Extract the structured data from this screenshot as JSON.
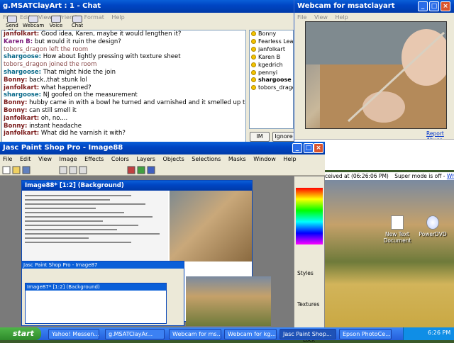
{
  "chat": {
    "title": "g.MSATClayArt : 1 - Chat",
    "menu": [
      "File",
      "Edit",
      "View",
      "Friend",
      "Format",
      "Help"
    ],
    "toolbar": [
      "Send File",
      "Webcam",
      "Voice",
      "Chat"
    ],
    "messages": [
      {
        "nick": "janfolkart:",
        "text": "Good idea, Karen, maybe it would lengthen it?",
        "color": "#7a1a1a"
      },
      {
        "nick": "Karen B:",
        "text": "but would it ruin the design?",
        "color": "#7a1a7a"
      },
      {
        "nick": "",
        "text": "tobors_dragon left the room",
        "color": "#8a4a4a"
      },
      {
        "nick": "shargoose:",
        "text": "How about lightly pressing with texture sheet",
        "color": "#0a6a8a"
      },
      {
        "nick": "",
        "text": "tobors_dragon joined the room",
        "color": "#8a4a4a"
      },
      {
        "nick": "shargoose:",
        "text": "That might hide the join",
        "color": "#0a6a8a"
      },
      {
        "nick": "Bonny:",
        "text": "back..that stunk lol",
        "color": "#7a1a1a"
      },
      {
        "nick": "janfolkart:",
        "text": "what happened?",
        "color": "#7a1a1a"
      },
      {
        "nick": "shargoose:",
        "text": "NJ goofed on the measurement",
        "color": "#0a6a8a"
      },
      {
        "nick": "Bonny:",
        "text": "hubby came in with a bowl he turned and varnished and it smelled up the joint",
        "color": "#7a1a1a"
      },
      {
        "nick": "Bonny:",
        "text": "can still smell it",
        "color": "#7a1a1a"
      },
      {
        "nick": "janfolkart:",
        "text": "oh, no....",
        "color": "#7a1a1a"
      },
      {
        "nick": "Bonny:",
        "text": "instant headache",
        "color": "#7a1a1a"
      },
      {
        "nick": "janfolkart:",
        "text": "What did he varnish it with?",
        "color": "#7a1a1a"
      }
    ],
    "users": [
      "Bonny",
      "Fearless Leader",
      "janfolkart",
      "Karen B",
      "kgedrich",
      "pennyi",
      "shargoose",
      "tobors_dragon"
    ],
    "bold_user": "shargoose",
    "im_button": "IM",
    "ignore_button": "Ignore U"
  },
  "webcam": {
    "title": "Webcam for msatclayart",
    "menu": [
      "File",
      "View",
      "Help"
    ],
    "report_link": "Report Abuse",
    "received": "ceived at (06:26:06 PM)",
    "super_mode": "Super mode is off -",
    "whats_this": "What's this?"
  },
  "psp": {
    "title": "Jasc Paint Shop Pro - Image88",
    "menu": [
      "File",
      "Edit",
      "View",
      "Image",
      "Effects",
      "Colors",
      "Layers",
      "Objects",
      "Selections",
      "Masks",
      "Window",
      "Help"
    ],
    "image_title": "Image88* [1:2] (Background)",
    "styles_label": "Styles",
    "textures_label": "Textures",
    "lock_label": "Lock",
    "nested_title": "Jasc Paint Shop Pro - Image87",
    "nested_image": "Image87* [1:2] (Background)"
  },
  "desktop": {
    "icons": [
      "New Text Document",
      "PowerDVD"
    ]
  },
  "taskbar": {
    "start": "start",
    "tasks": [
      "Yahoo! Messen...",
      "g.MSATClayAr...",
      "Webcam for ms...",
      "Webcam for kg...",
      "Jasc Paint Shop...",
      "Epson PhotoCe..."
    ],
    "clock": "6:26 PM"
  }
}
